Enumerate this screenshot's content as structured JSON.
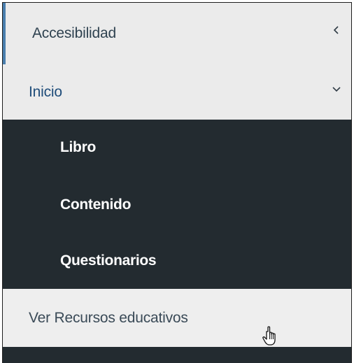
{
  "menu": {
    "accesibilidad": {
      "label": "Accesibilidad",
      "icon": "chevron-left-icon"
    },
    "inicio": {
      "label": "Inicio",
      "icon": "chevron-down-icon",
      "expanded": true,
      "children": [
        {
          "label": "Libro"
        },
        {
          "label": "Contenido"
        },
        {
          "label": "Questionarios"
        }
      ]
    },
    "recursos": {
      "label": "Ver Recursos educativos"
    }
  },
  "colors": {
    "active_border": "#4a7fae",
    "dark_background": "#232b30",
    "light_background": "#ebebeb"
  },
  "cursor": {
    "icon": "hand-pointer-icon"
  }
}
